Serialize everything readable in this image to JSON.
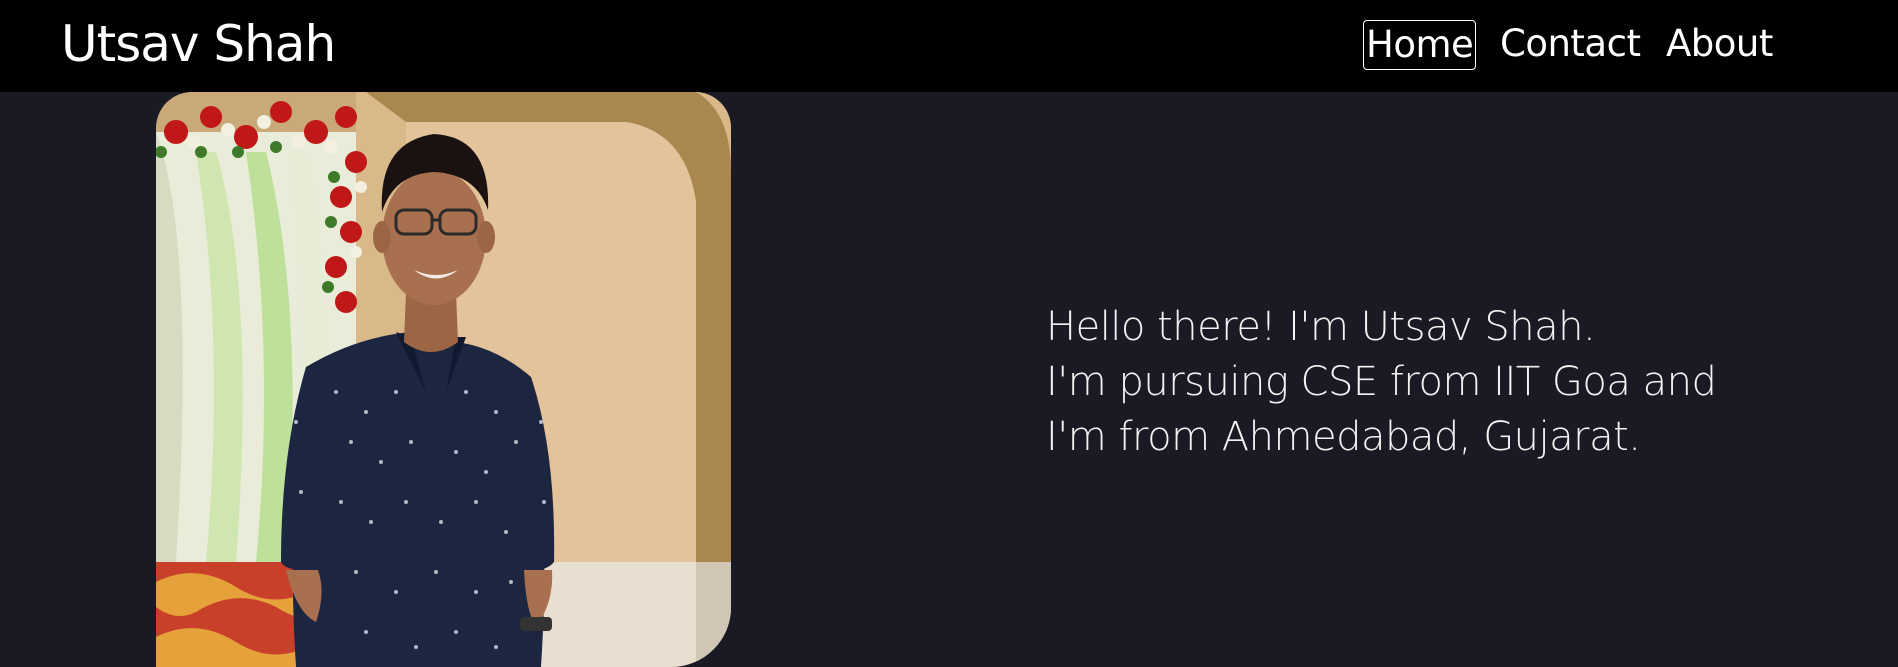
{
  "site": {
    "brand": "Utsav Shah"
  },
  "nav": {
    "items": [
      {
        "label": "Home",
        "active": true
      },
      {
        "label": "Contact",
        "active": false
      },
      {
        "label": "About",
        "active": false
      }
    ]
  },
  "hero": {
    "image_alt": "portrait-photo",
    "lines": [
      "Hello there! I'm Utsav Shah.",
      "I'm pursuing CSE from IIT Goa and",
      "I'm from Ahmedabad, Gujarat."
    ]
  },
  "colors": {
    "page_bg": "#1a1a24",
    "navbar_bg": "#000000",
    "text": "#ffffff"
  }
}
